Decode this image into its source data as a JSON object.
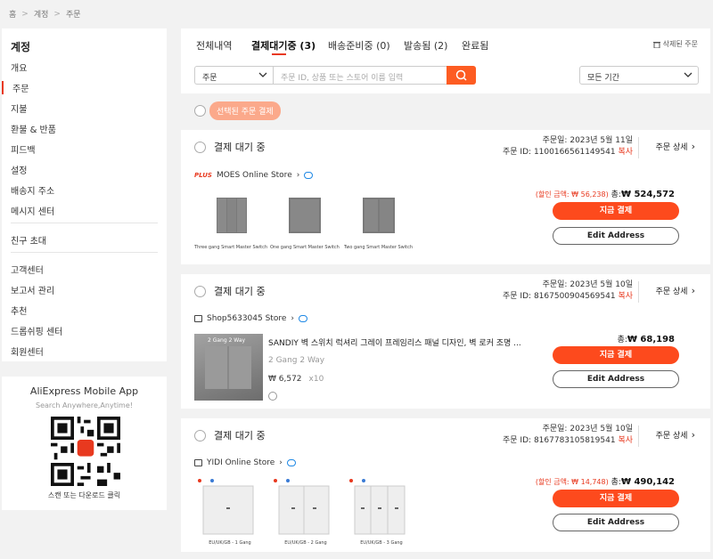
{
  "breadcrumb": [
    "홈",
    "계정",
    "주문"
  ],
  "sidebar": {
    "title": "계정",
    "items": [
      "개요",
      "주문",
      "지불",
      "환불 & 반품",
      "피드백",
      "설정",
      "배송지 주소",
      "메시지 센터",
      "친구 초대",
      "고객센터",
      "보고서 관리",
      "추천",
      "드롭쉬핑 센터",
      "회원센터"
    ]
  },
  "app": {
    "title": "AliExpress Mobile App",
    "subtitle": "Search Anywhere,Anytime!",
    "caption": "스캔 또는 다운로드 클릭"
  },
  "tabs": [
    "전체내역",
    "결제대기중 (3)",
    "배송준비중 (0)",
    "발송됨 (2)",
    "완료됨"
  ],
  "deleted_orders": "삭제된 주문",
  "search": {
    "select_value": "주문",
    "placeholder": "주문 ID, 상품 또는 스토어 이름 입력",
    "period": "모든 기간"
  },
  "pay_selected": "선택된 주문 결제",
  "labels": {
    "status": "결제 대기 중",
    "order_date_prefix": "주문일:",
    "order_id_prefix": "주문 ID:",
    "copy": "복사",
    "detail": "주문 상세",
    "pay_now": "지금 결제",
    "edit_address": "Edit Address",
    "total_prefix": "총:"
  },
  "orders": [
    {
      "date": "2023년 5월 11일",
      "id": "1100166561149541",
      "store_badge": "PLUS",
      "store": "MOES Online Store",
      "discount": "(할인 금액: ₩ 56,238)",
      "total": "₩ 524,572",
      "items": [
        {
          "caption": "Three gang Smart Master Switch"
        },
        {
          "caption": "One gang Smart Master Switch"
        },
        {
          "caption": "Two gang Smart Master Switch"
        }
      ]
    },
    {
      "date": "2023년 5월 10일",
      "id": "8167500904569541",
      "store": "Shop5633045 Store",
      "total": "₩ 68,198",
      "product": {
        "image_caption": "2 Gang 2 Way",
        "title": "SANDIY 벽 스위치 럭셔리 그레이 프레임리스 패널 디자인, 벽 로커 조명 ...",
        "variant": "2 Gang 2 Way",
        "price": "₩ 6,572",
        "qty": "x10"
      }
    },
    {
      "date": "2023년 5월 10일",
      "id": "8167783105819541",
      "store": "YIDI Online Store",
      "discount": "(할인 금액: ₩ 14,748)",
      "total": "₩ 490,142",
      "items": [
        {
          "caption": "EU/UK/GB - 1 Gang"
        },
        {
          "caption": "EU/UK/GB - 2 Gang"
        },
        {
          "caption": "EU/UK/GB - 3 Gang"
        }
      ]
    }
  ],
  "colors": {
    "accent": "#fd4a1d",
    "link": "#1e88e5",
    "page_bg": "#f2f2f2"
  }
}
